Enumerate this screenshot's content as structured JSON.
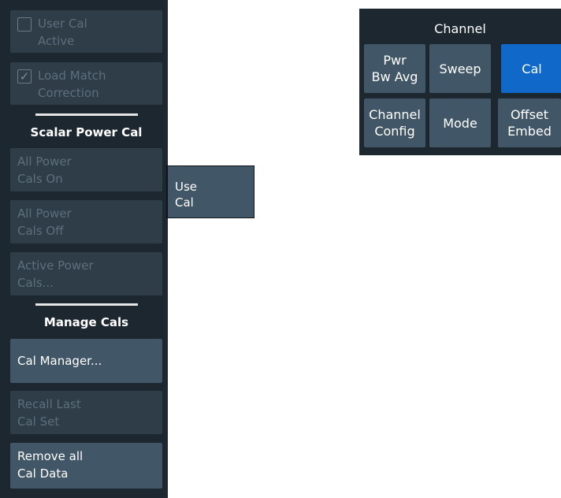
{
  "cal_panel": {
    "user_cal_active": {
      "label": "User Cal Active",
      "line1": "User Cal",
      "line2": "Active",
      "checked": false
    },
    "load_match_correction": {
      "label": "Load Match Correction",
      "line1": "Load Match",
      "line2": "Correction",
      "checked": true,
      "check_glyph": "✓"
    },
    "scalar_power_cal": {
      "heading": "Scalar Power Cal",
      "all_power_cals_on": {
        "line1": "All Power",
        "line2": "Cals On"
      },
      "all_power_cals_off": {
        "line1": "All Power",
        "line2": "Cals Off"
      },
      "active_power_cals": {
        "line1": "Active Power",
        "line2": "Cals..."
      }
    },
    "manage_cals": {
      "heading": "Manage Cals",
      "cal_manager": {
        "label": "Cal Manager..."
      },
      "recall_last_cal_set": {
        "line1": "Recall Last",
        "line2": "Cal Set"
      },
      "remove_all_cal_data": {
        "line1": "Remove all",
        "line2": "Cal Data"
      }
    }
  },
  "use_cal_button": {
    "line1": "Use",
    "line2": "Cal"
  },
  "channel_group": {
    "title": "Channel",
    "buttons": [
      {
        "line1": "Pwr",
        "line2": "Bw Avg",
        "active": false
      },
      {
        "line1": "Sweep",
        "line2": "",
        "active": false
      },
      {
        "line1": "Cal",
        "line2": "",
        "active": true
      },
      {
        "line1": "Channel",
        "line2": "Config",
        "active": false
      },
      {
        "line1": "Mode",
        "line2": "",
        "active": false
      },
      {
        "line1": "Offset",
        "line2": "Embed",
        "active": false
      }
    ]
  },
  "colors": {
    "panel_bg": "#1d2730",
    "disabled_key_bg": "#2e3d48",
    "enabled_key_bg": "#415666",
    "disabled_text": "#5d6f7c",
    "active_accent": "#1069c9"
  }
}
